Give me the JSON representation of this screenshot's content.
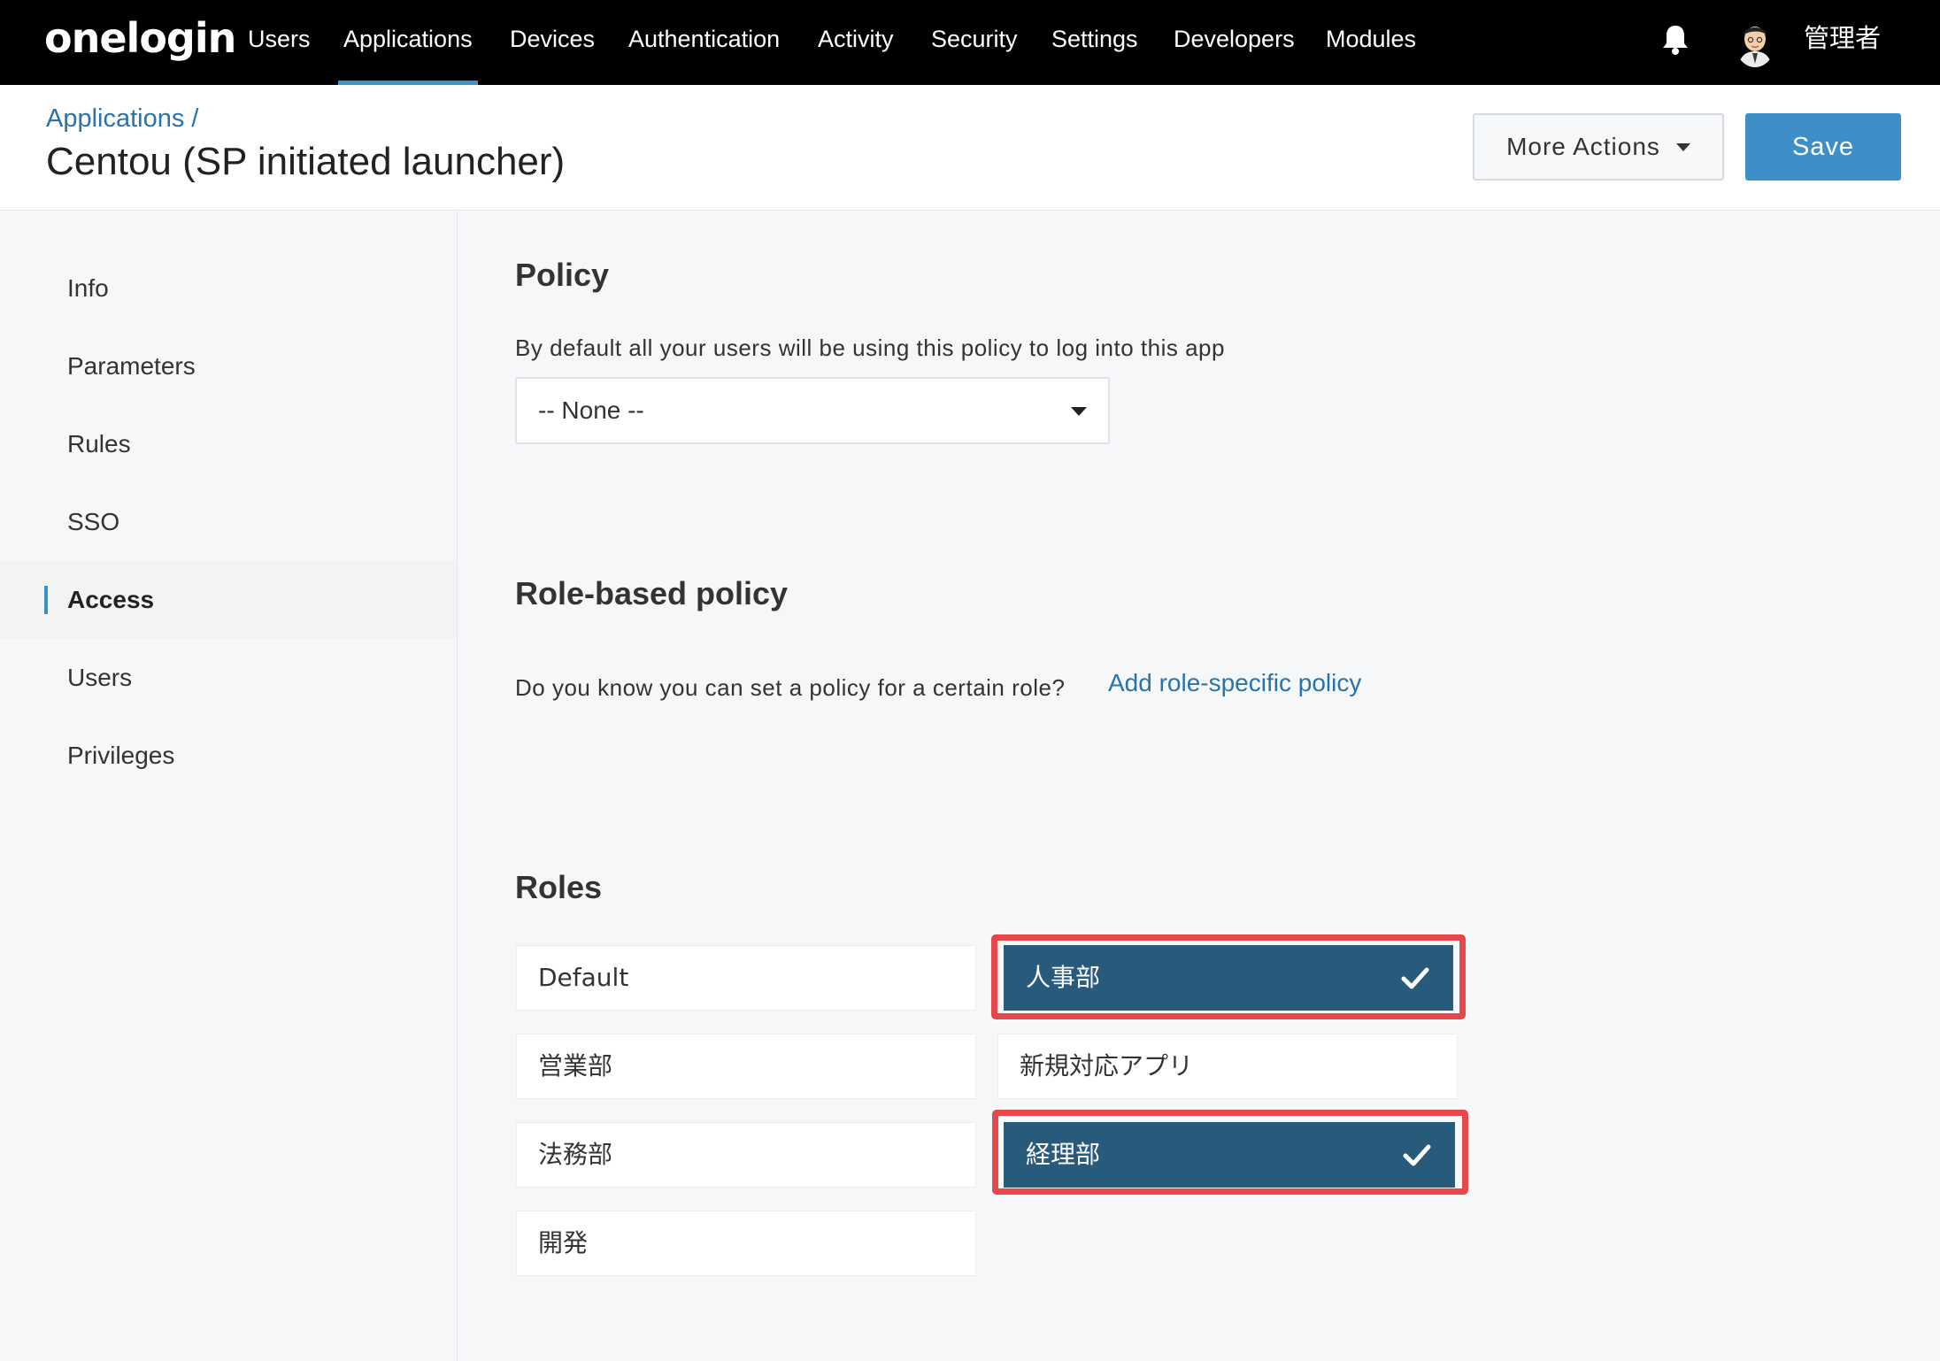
{
  "nav": {
    "logo": "onelogin",
    "items": [
      "Users",
      "Applications",
      "Devices",
      "Authentication",
      "Activity",
      "Security",
      "Settings",
      "Developers",
      "Modules"
    ],
    "active": "Applications",
    "admin_name": "管理者"
  },
  "header": {
    "breadcrumb": "Applications /",
    "title": "Centou (SP initiated launcher)",
    "more_actions_label": "More Actions",
    "save_label": "Save"
  },
  "sidebar": {
    "items": [
      "Info",
      "Parameters",
      "Rules",
      "SSO",
      "Access",
      "Users",
      "Privileges"
    ],
    "active": "Access"
  },
  "policy": {
    "title": "Policy",
    "description": "By default all your users will be using this policy to log into this app",
    "selected": "-- None --"
  },
  "role_policy": {
    "title": "Role-based policy",
    "description": "Do you know you can set a policy for a certain role?",
    "link": "Add role-specific policy"
  },
  "roles": {
    "title": "Roles",
    "items": [
      {
        "label": "Default",
        "selected": false
      },
      {
        "label": "人事部",
        "selected": true
      },
      {
        "label": "営業部",
        "selected": false
      },
      {
        "label": "新規対応アプリ",
        "selected": false
      },
      {
        "label": "法務部",
        "selected": false
      },
      {
        "label": "経理部",
        "selected": true
      },
      {
        "label": "開発",
        "selected": false
      }
    ]
  },
  "colors": {
    "accent": "#3e8fc7",
    "selected_role_bg": "#285a7c",
    "highlight": "#e5474b"
  }
}
